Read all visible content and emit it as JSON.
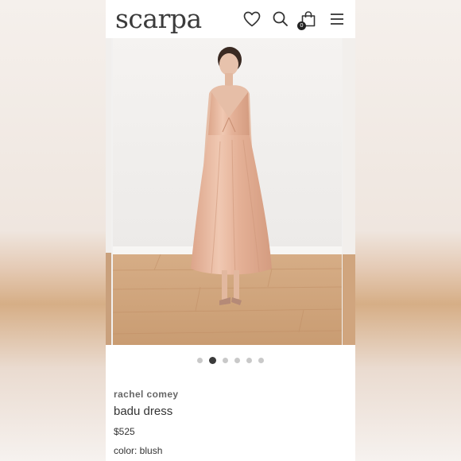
{
  "header": {
    "logo": "scarpa",
    "icons": [
      "heart-icon",
      "search-icon",
      "bag-icon",
      "menu-icon"
    ],
    "bag_count": "0"
  },
  "gallery": {
    "slide_count": 6,
    "active_index": 1
  },
  "product": {
    "brand": "rachel comey",
    "name": "badu dress",
    "price": "$525",
    "color": "color: blush"
  },
  "colors": {
    "dress": "#e5b49c",
    "floor": "#d9b28c",
    "wall": "#f4f2f0",
    "dot_active": "#3a3a3a",
    "dot_inactive": "#c9c9c9"
  }
}
